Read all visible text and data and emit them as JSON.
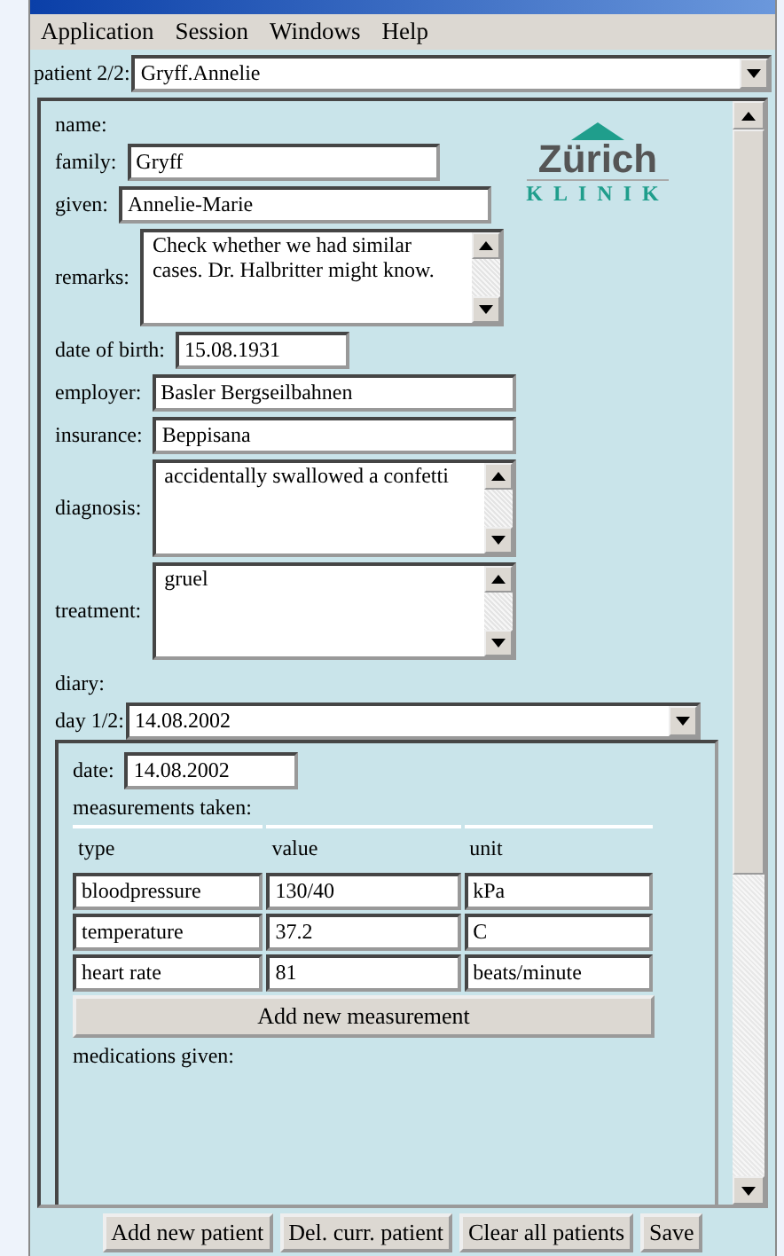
{
  "menu": [
    "Application",
    "Session",
    "Windows",
    "Help"
  ],
  "patient_selector": {
    "label": "patient 2/2:",
    "value": "Gryff.Annelie"
  },
  "logo": {
    "title": "Zürich",
    "subtitle": "KLINIK"
  },
  "name_heading": "name:",
  "fields": [
    {
      "kind": "input",
      "label": "family:",
      "value": "Gryff"
    },
    {
      "kind": "input",
      "label": "given:",
      "value": "Annelie-Marie"
    },
    {
      "kind": "textarea",
      "label": "remarks:",
      "value": "Check whether we had similar cases. Dr. Halbritter might know."
    },
    {
      "kind": "input",
      "label": "date of birth:",
      "value": "15.08.1931"
    },
    {
      "kind": "input",
      "label": "employer:",
      "value": "Basler Bergseilbahnen"
    },
    {
      "kind": "input",
      "label": "insurance:",
      "value": "Beppisana"
    },
    {
      "kind": "textarea",
      "label": "diagnosis:",
      "value": "accidentally swallowed a confetti"
    },
    {
      "kind": "textarea",
      "label": "treatment:",
      "value": "gruel"
    }
  ],
  "diary": {
    "heading": "diary:",
    "day_label": "day 1/2:",
    "day_value": "14.08.2002",
    "date_label": "date:",
    "date_value": "14.08.2002",
    "measurements_heading": "measurements taken:",
    "columns": [
      "type",
      "value",
      "unit"
    ],
    "rows": [
      [
        "bloodpressure",
        "130/40",
        "kPa"
      ],
      [
        "temperature",
        "37.2",
        "C"
      ],
      [
        "heart rate",
        "81",
        "beats/minute"
      ]
    ],
    "add_button": "Add new measurement",
    "medications_heading": "medications given:"
  },
  "buttons": [
    "Add new patient",
    "Del. curr. patient",
    "Clear all patients",
    "Save"
  ]
}
